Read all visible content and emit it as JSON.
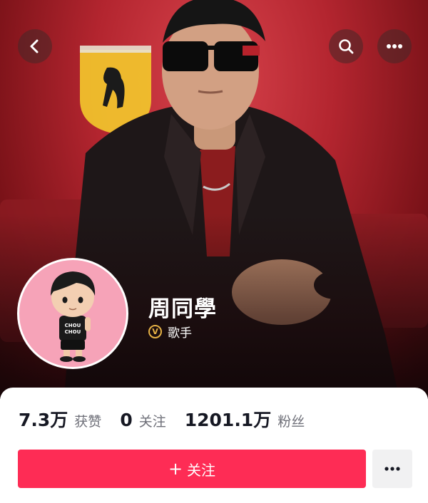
{
  "header": {
    "back_icon": "chevron-left-icon",
    "search_icon": "search-icon",
    "more_icon": "more-dots-icon"
  },
  "profile": {
    "name": "周同學",
    "verified_badge": "V",
    "verified_label": "歌手"
  },
  "stats": [
    {
      "value": "7.3万",
      "label": "获赞"
    },
    {
      "value": "0",
      "label": "关注"
    },
    {
      "value": "1201.1万",
      "label": "粉丝"
    }
  ],
  "actions": {
    "follow_plus": "+",
    "follow_label": "关注",
    "more_icon": "more-dots-icon"
  },
  "colors": {
    "accent": "#fe2c55",
    "badge_gold": "#e6b245",
    "hero_red": "#b3252f"
  }
}
